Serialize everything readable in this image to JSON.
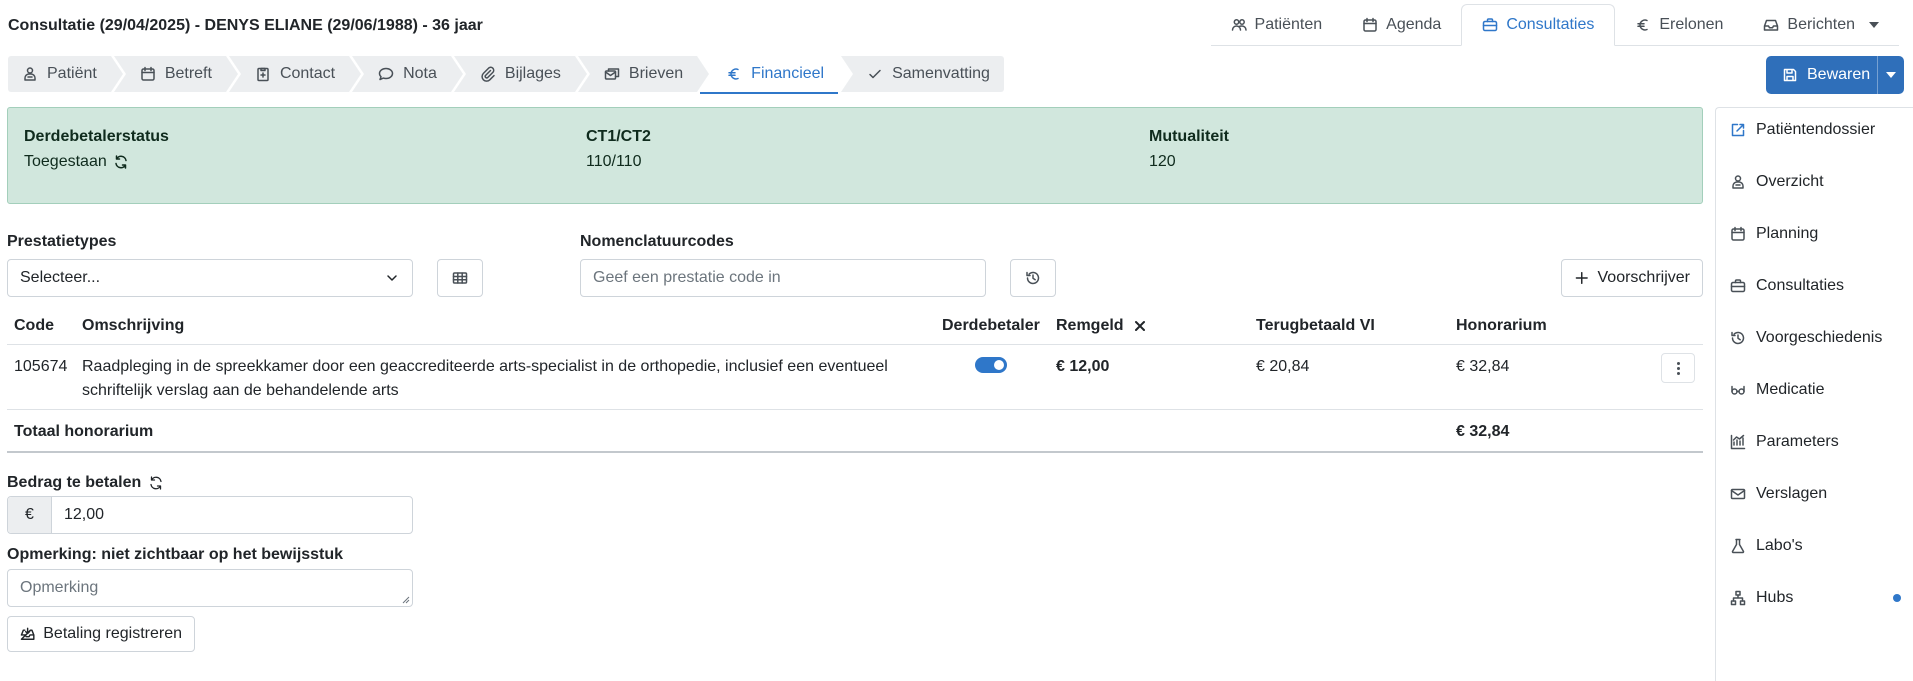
{
  "header": {
    "title": "Consultatie (29/04/2025) - DENYS ELIANE (29/06/1988) - 36 jaar",
    "nav": [
      {
        "label": "Patiënten",
        "icon": "users-icon"
      },
      {
        "label": "Agenda",
        "icon": "calendar-icon"
      },
      {
        "label": "Consultaties",
        "icon": "briefcase-icon",
        "active": true
      },
      {
        "label": "Erelonen",
        "icon": "euro-icon"
      },
      {
        "label": "Berichten",
        "icon": "inbox-icon"
      }
    ]
  },
  "steps": [
    {
      "label": "Patiënt",
      "icon": "person-icon"
    },
    {
      "label": "Betreft",
      "icon": "calendar-icon"
    },
    {
      "label": "Contact",
      "icon": "clipboard-plus-icon"
    },
    {
      "label": "Nota",
      "icon": "chat-icon"
    },
    {
      "label": "Bijlages",
      "icon": "paperclip-icon"
    },
    {
      "label": "Brieven",
      "icon": "letters-icon"
    },
    {
      "label": "Financieel",
      "icon": "euro-icon",
      "active": true
    },
    {
      "label": "Samenvatting",
      "icon": "check-icon"
    }
  ],
  "save_button": {
    "label": "Bewaren"
  },
  "status": {
    "derdebetaler_label": "Derdebetalerstatus",
    "derdebetaler_value": "Toegestaan",
    "ct_label": "CT1/CT2",
    "ct_value": "110/110",
    "mutualiteit_label": "Mutualiteit",
    "mutualiteit_value": "120"
  },
  "form": {
    "prestatietypes_label": "Prestatietypes",
    "prestatietypes_value": "Selecteer...",
    "nomenclatuur_label": "Nomenclatuurcodes",
    "nomenclatuur_placeholder": "Geef een prestatie code in",
    "voorschrijver_label": "Voorschrijver"
  },
  "table": {
    "headers": {
      "code": "Code",
      "omschrijving": "Omschrijving",
      "derdebetaler": "Derdebetaler",
      "remgeld": "Remgeld",
      "terugbetaald": "Terugbetaald VI",
      "honorarium": "Honorarium"
    },
    "rows": [
      {
        "code": "105674",
        "omschrijving_line1": "Raadpleging in de spreekkamer door een geaccrediteerde arts-specialist in de orthopedie, inclusief een eventueel",
        "omschrijving_line2": "schriftelijk verslag aan de behandelende arts",
        "derdebetaler": true,
        "remgeld": "€ 12,00",
        "terugbetaald": "€ 20,84",
        "honorarium": "€ 32,84"
      }
    ],
    "total_label": "Totaal honorarium",
    "total_value": "€ 32,84"
  },
  "payment": {
    "bedrag_label": "Bedrag te betalen",
    "currency": "€",
    "bedrag_value": "12,00",
    "opmerking_label": "Opmerking: niet zichtbaar op het bewijsstuk",
    "opmerking_placeholder": "Opmerking",
    "register_label": "Betaling registreren"
  },
  "sidebar": {
    "items": [
      {
        "label": "Patiëntendossier",
        "icon": "external-edit-icon"
      },
      {
        "label": "Overzicht",
        "icon": "person-icon"
      },
      {
        "label": "Planning",
        "icon": "calendar-icon"
      },
      {
        "label": "Consultaties",
        "icon": "briefcase-icon"
      },
      {
        "label": "Voorgeschiedenis",
        "icon": "history-icon"
      },
      {
        "label": "Medicatie",
        "icon": "eyeglasses-icon"
      },
      {
        "label": "Parameters",
        "icon": "graph-icon"
      },
      {
        "label": "Verslagen",
        "icon": "envelope-icon"
      },
      {
        "label": "Labo's",
        "icon": "flask-icon"
      },
      {
        "label": "Hubs",
        "icon": "diagram-icon"
      }
    ]
  },
  "colors": {
    "accent": "#2f77c9",
    "success_bg": "#d1e7dd",
    "primary_button": "#2f6fba"
  }
}
